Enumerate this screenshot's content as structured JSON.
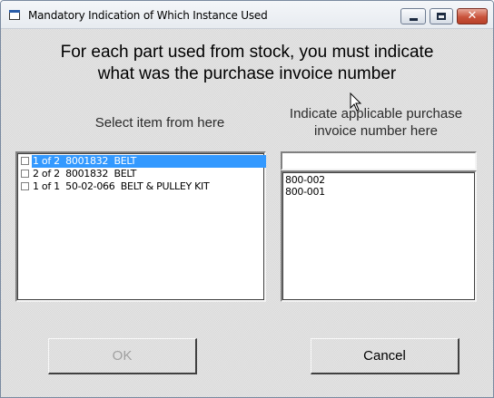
{
  "window": {
    "title": "Mandatory Indication of Which Instance Used",
    "controls": {
      "minimize": "minimize",
      "maximize": "maximize",
      "close": "✕"
    }
  },
  "heading": {
    "line1": "For each part used from stock, you must indicate",
    "line2": "what was the purchase invoice number"
  },
  "left_panel": {
    "label": "Select item from here",
    "items": [
      {
        "text": "1 of 2  8001832  BELT",
        "selected": true,
        "checked": false
      },
      {
        "text": "2 of 2  8001832  BELT",
        "selected": false,
        "checked": false
      },
      {
        "text": "1 of 1  50-02-066  BELT & PULLEY KIT",
        "selected": false,
        "checked": false
      }
    ]
  },
  "right_panel": {
    "label_line1": "Indicate applicable purchase",
    "label_line2": "invoice number here",
    "input_value": "",
    "invoices": [
      "800-002",
      "800-001"
    ]
  },
  "buttons": {
    "ok": {
      "label": "OK",
      "enabled": false
    },
    "cancel": {
      "label": "Cancel",
      "enabled": true
    }
  },
  "colors": {
    "selection": "#3399ff",
    "disabled_text": "#a0a0a0"
  }
}
